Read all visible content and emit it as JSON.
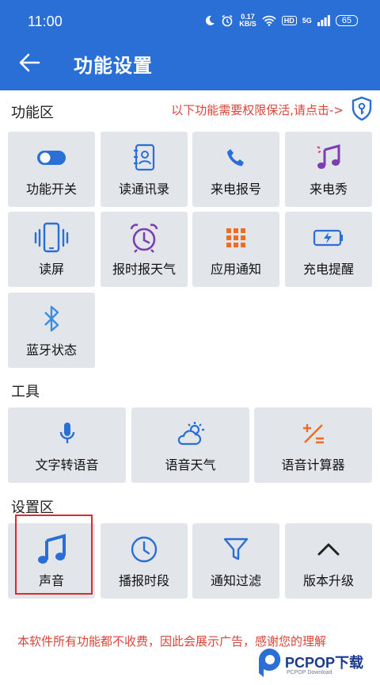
{
  "status_bar": {
    "time": "11:00",
    "speed_value": "0.17",
    "speed_unit": "KB/S",
    "hd": "HD",
    "network": "5G",
    "battery": "65"
  },
  "header": {
    "title": "功能设置"
  },
  "sections": {
    "features": "功能区",
    "tools": "工具",
    "settings": "设置区"
  },
  "permission_hint": "以下功能需要权限保活,请点击->",
  "features": [
    {
      "label": "功能开关",
      "icon": "toggle-icon"
    },
    {
      "label": "读通讯录",
      "icon": "contacts-icon"
    },
    {
      "label": "来电报号",
      "icon": "phone-icon"
    },
    {
      "label": "来电秀",
      "icon": "music-note-icon"
    },
    {
      "label": "读屏",
      "icon": "phone-vibrate-icon"
    },
    {
      "label": "报时报天气",
      "icon": "alarm-clock-icon"
    },
    {
      "label": "应用通知",
      "icon": "app-grid-icon"
    },
    {
      "label": "充电提醒",
      "icon": "battery-charge-icon"
    },
    {
      "label": "蓝牙状态",
      "icon": "bluetooth-icon"
    }
  ],
  "tools": [
    {
      "label": "文字转语音",
      "icon": "microphone-icon"
    },
    {
      "label": "语音天气",
      "icon": "weather-icon"
    },
    {
      "label": "语音计算器",
      "icon": "calculator-icon"
    }
  ],
  "settings": [
    {
      "label": "声音",
      "icon": "music-note-icon"
    },
    {
      "label": "播报时段",
      "icon": "clock-icon"
    },
    {
      "label": "通知过滤",
      "icon": "filter-icon"
    },
    {
      "label": "版本升级",
      "icon": "chevron-up-icon"
    }
  ],
  "footer_note": "本软件所有功能都不收费，因此会展示广告，感谢您的理解",
  "watermark": {
    "brand": "PCPOP下载",
    "sub": "PCPOP Download"
  },
  "colors": {
    "primary": "#2a6fd6",
    "accent_red": "#d9453b",
    "purple": "#7b3fb0",
    "orange": "#ef6c23",
    "tile_bg": "#e2e5e9"
  }
}
